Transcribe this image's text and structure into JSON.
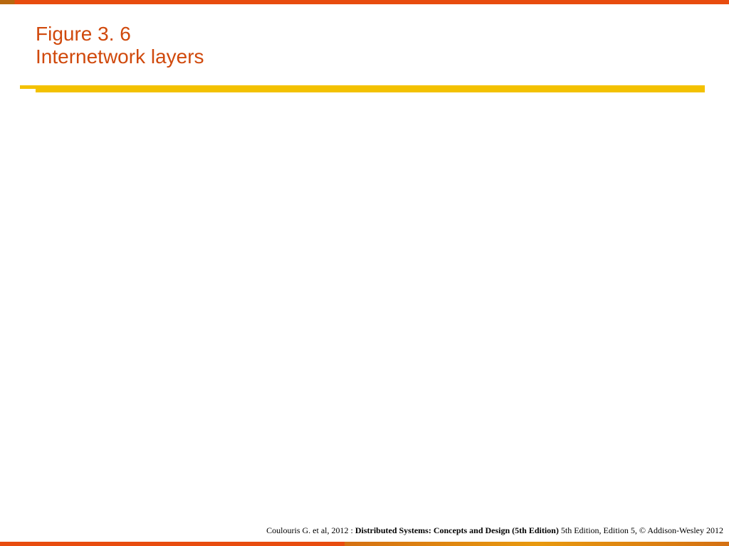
{
  "header": {
    "title_line1": "Figure 3. 6",
    "title_line2": "Internetwork layers"
  },
  "footer": {
    "author": "Coulouris G. et al, 2012 : ",
    "book_title": "Distributed Systems: Concepts and Design (5th Edition)",
    "edition_info": " 5th Edition, Edition 5, © Addison-Wesley 2012"
  }
}
